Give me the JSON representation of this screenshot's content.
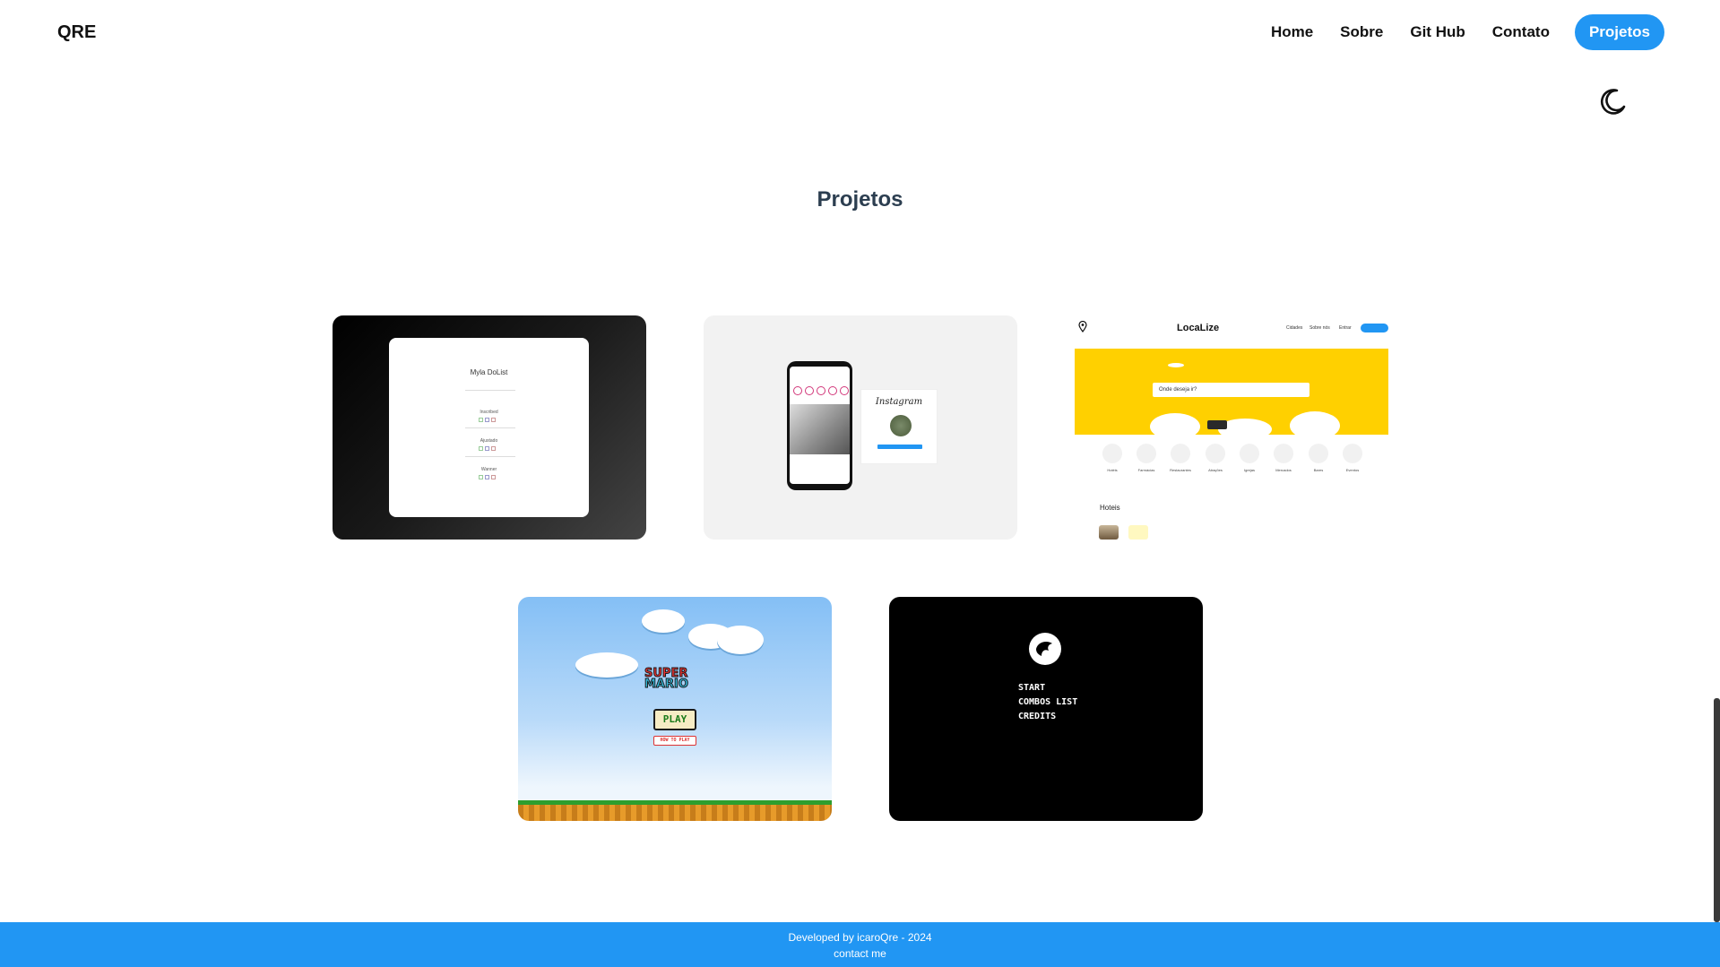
{
  "header": {
    "logo": "QRE",
    "nav": [
      {
        "label": "Home"
      },
      {
        "label": "Sobre"
      },
      {
        "label": "Git Hub"
      },
      {
        "label": "Contato"
      },
      {
        "label": "Projetos"
      }
    ],
    "active_nav": "Projetos",
    "theme_toggle_icon": "moon-icon"
  },
  "main": {
    "title": "Projetos",
    "projects": [
      {
        "name": "todo-list",
        "preview_title": "Myla DoList",
        "preview_items": [
          "Inscribed",
          "Ajustado",
          "Wanner"
        ]
      },
      {
        "name": "instagram-clone",
        "preview_logo": "Instagram"
      },
      {
        "name": "localize",
        "preview_logo": "LocaLize",
        "preview_nav": [
          "Cidades",
          "Sobre nós",
          "Entrar"
        ],
        "preview_search_placeholder": "Onde deseja ir?",
        "preview_categories": [
          "Hotéis",
          "Farmácias",
          "Restaurantes",
          "Atrações",
          "Igrejas",
          "Mercados",
          "Bares",
          "Eventos"
        ],
        "preview_section": "Hoteis"
      },
      {
        "name": "super-mario",
        "preview_logo_line1": "SUPER",
        "preview_logo_line2": "MARIO",
        "preview_play": "PLAY",
        "preview_howto": "HOW TO PLAY"
      },
      {
        "name": "mortal-kombat",
        "preview_menu": [
          "START",
          "COMBOS LIST",
          "CREDITS"
        ]
      }
    ]
  },
  "footer": {
    "developed_by": "Developed by icaroQre - 2024",
    "contact": "contact me"
  },
  "colors": {
    "accent": "#2196f3",
    "title": "#2c3e50",
    "background": "#ffffff"
  }
}
